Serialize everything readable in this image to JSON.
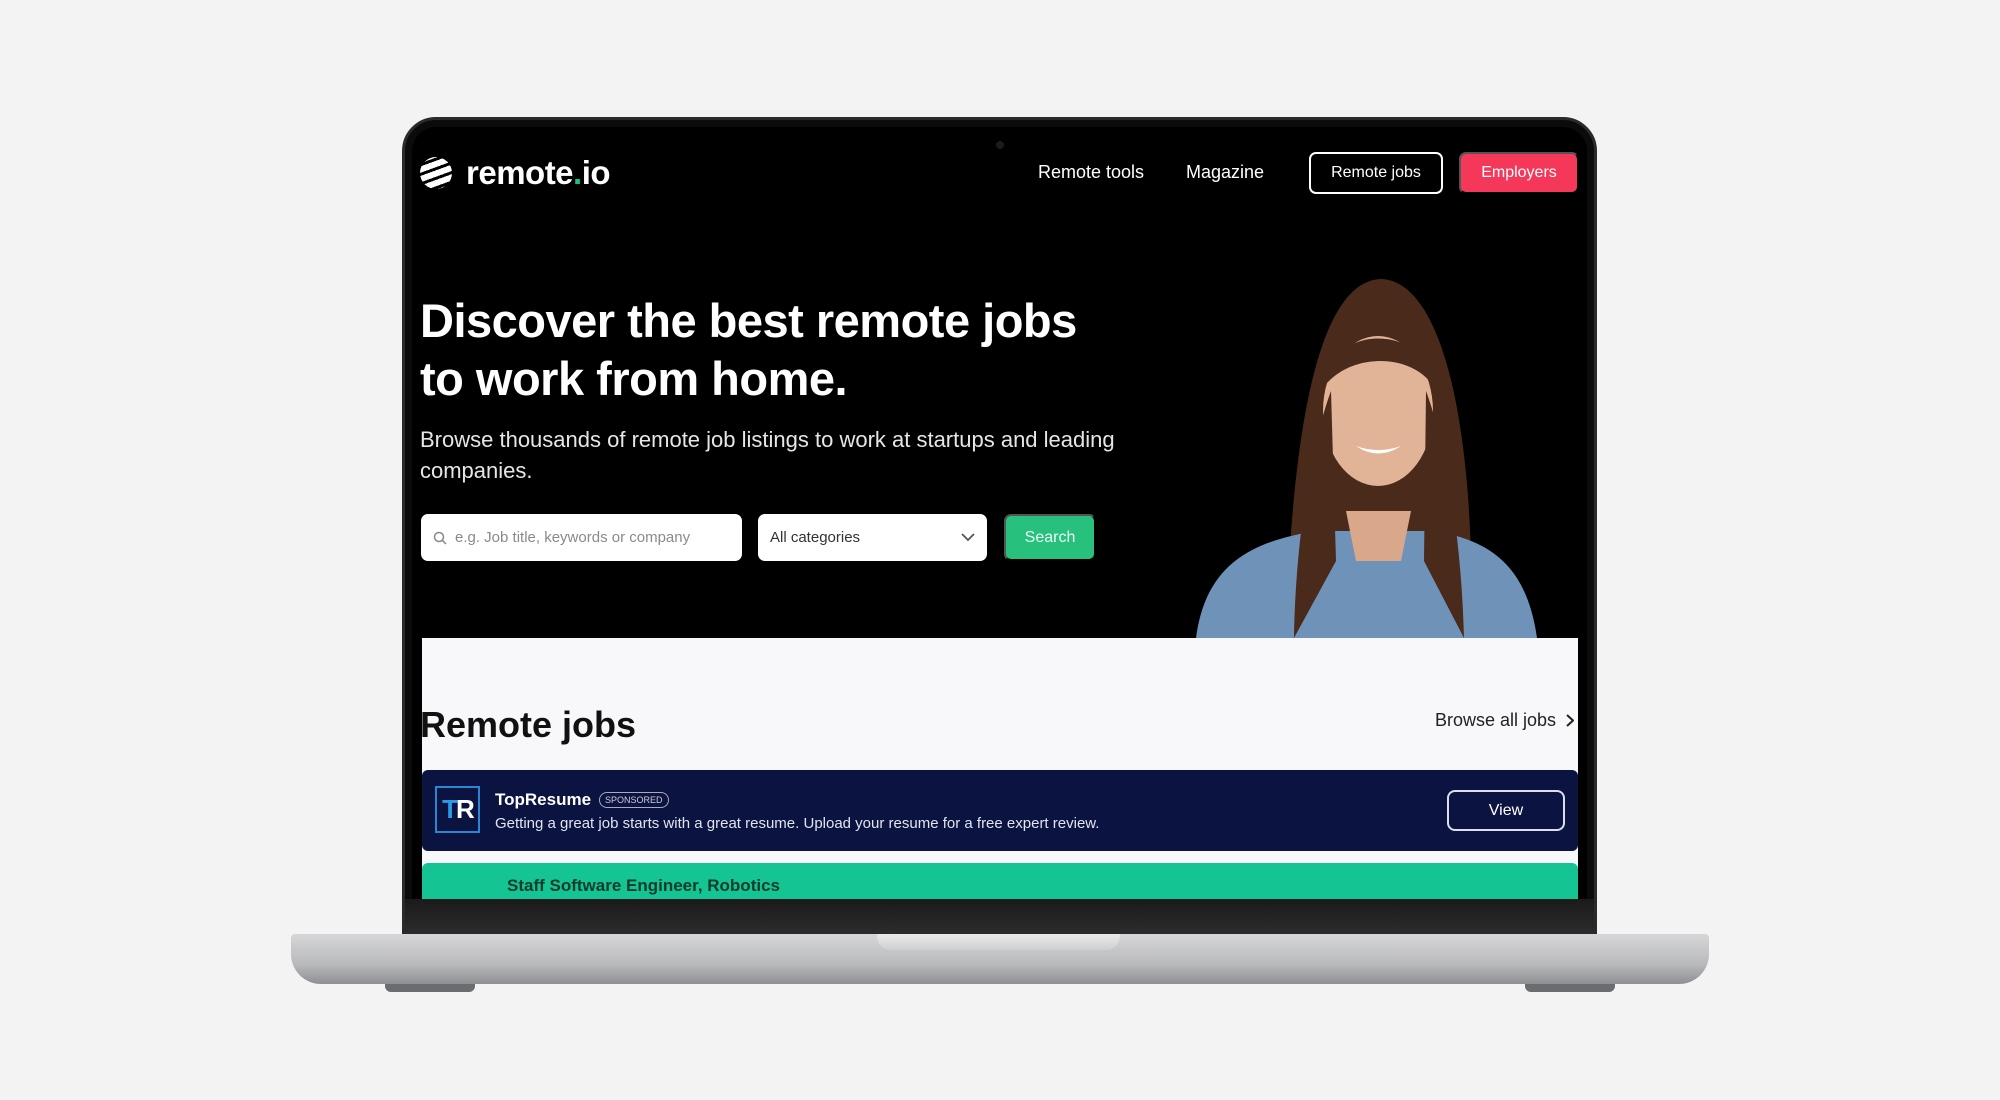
{
  "nav": {
    "logo": "remote",
    "logo_dot": ".",
    "logo_suffix": "io",
    "links": [
      "Remote tools",
      "Magazine"
    ],
    "remote_jobs": "Remote jobs",
    "employers": "Employers"
  },
  "hero": {
    "title": "Discover the best remote jobs to work from home.",
    "subtitle": "Browse thousands of remote job listings to work at startups and leading companies.",
    "search_placeholder": "e.g. Job title, keywords or company",
    "category": "All categories",
    "search_button": "Search"
  },
  "jobs": {
    "title": "Remote jobs",
    "browse_all": "Browse all jobs",
    "sponsored": {
      "logo": "TR",
      "name": "TopResume",
      "badge": "SPONSORED",
      "description": "Getting a great job starts with a great resume. Upload your resume for a free expert review.",
      "button": "View"
    },
    "first_job": "Staff Software Engineer, Robotics"
  },
  "colors": {
    "accent_green": "#27c07d",
    "employers_red": "#f5385a",
    "banner_navy": "#0b1340"
  }
}
